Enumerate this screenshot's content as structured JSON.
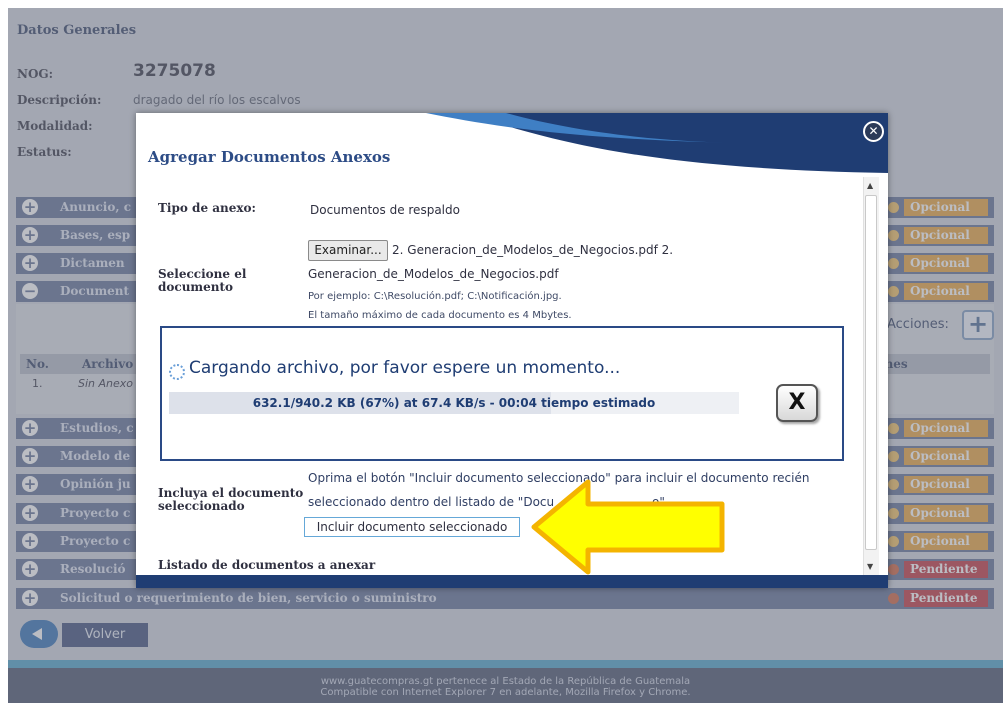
{
  "background": {
    "section_title": "Datos Generales",
    "nog_label": "NOG:",
    "nog_value": "3275078",
    "descripcion_label": "Descripción:",
    "descripcion_value": "dragado del río los escalvos",
    "modalidad_label": "Modalidad:",
    "estatus_label": "Estatus:",
    "rows": [
      {
        "text": "Anuncio, c",
        "status": "Opcional"
      },
      {
        "text": "Bases, esp",
        "status": "Opcional"
      },
      {
        "text": "Dictamen",
        "status": "Opcional"
      },
      {
        "text": "Document",
        "status": "Opcional"
      },
      {
        "text": "Estudios, c",
        "status": "Opcional"
      },
      {
        "text": "Modelo de",
        "status": "Opcional"
      },
      {
        "text": "Opinión ju",
        "status": "Opcional"
      },
      {
        "text": "Proyecto c",
        "status": "Opcional"
      },
      {
        "text": "Proyecto c",
        "status": "Opcional"
      },
      {
        "text": "Resolució",
        "status": "Pendiente"
      },
      {
        "text": "Solicitud o requerimiento de bien, servicio o suministro",
        "status": "Pendiente"
      }
    ],
    "acciones_label": "Acciones:",
    "table_headers": {
      "no": "No.",
      "archivo": "Archivo",
      "acciones": "iones"
    },
    "table_row": {
      "no": "1.",
      "archivo": "Sin Anexo"
    },
    "volver_label": "Volver",
    "footer_line1": "www.guatecompras.gt pertenece al Estado de la República de Guatemala",
    "footer_line2": "Compatible con Internet Explorer 7 en adelante, Mozilla Firefox y Chrome."
  },
  "modal": {
    "title": "Agregar Documentos Anexos",
    "tipo_label": "Tipo de anexo:",
    "tipo_value": "Documentos de respaldo",
    "examinar_label": "Examinar...",
    "file_name_1": "2. Generacion_de_Modelos_de_Negocios.pdf 2.",
    "file_name_2": "Generacion_de_Modelos_de_Negocios.pdf",
    "seleccione_label_1": "Seleccione el",
    "seleccione_label_2": "documento",
    "example_text": "Por ejemplo: C:\\Resolución.pdf; C:\\Notificación.jpg.",
    "max_size_text": "El tamaño máximo de cada documento es 4 Mbytes.",
    "loading_text": "Cargando archivo, por favor espere un momento...",
    "progress_text": "632.1/940.2 KB (67%) at 67.4 KB/s - 00:04 tiempo estimado",
    "progress_fraction": 0.67,
    "cancel_label": "X",
    "incluya_label_1": "Incluya el documento",
    "incluya_label_2": "seleccionado",
    "instruction_1": "Oprima el botón \"Incluir documento seleccionado\" para incluir el documento recién",
    "instruction_2a": "seleccionado dentro del listado de \"Docu",
    "instruction_2b": "o\".",
    "incluir_label": "Incluir documento seleccionado",
    "listado_label": "Listado de documentos a anexar"
  },
  "colors": {
    "accent_blue": "#1f3d73",
    "opcional": "#e8a33a",
    "pendiente": "#c0323d",
    "arrow_yellow": "#ffff00",
    "arrow_border": "#f4b400"
  },
  "icons": {
    "close": "close-icon",
    "spinner": "spinner-icon",
    "expand": "plus-circle-icon",
    "arrow": "arrow-left-icon"
  }
}
